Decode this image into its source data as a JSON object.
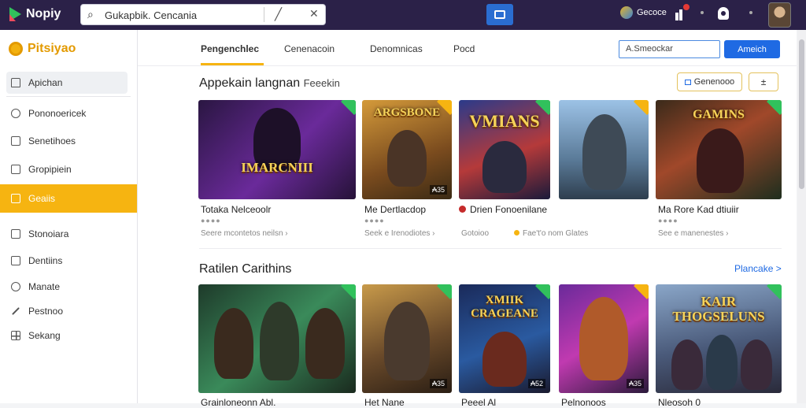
{
  "topbar": {
    "app_name": "Nopiy",
    "search_value": "Gukapbik. Cencania",
    "account_label": "Gecoce"
  },
  "sidebar": {
    "brand": "Pitsiyao",
    "items": [
      {
        "label": "Apichan",
        "icon": "home-icon"
      },
      {
        "label": "Pononoericek",
        "icon": "circle-icon"
      },
      {
        "label": "Senetihoes",
        "icon": "card-icon"
      },
      {
        "label": "Gropipiein",
        "icon": "window-icon"
      },
      {
        "label": "Geaiis",
        "icon": "square-icon"
      },
      {
        "label": "Stonoiara",
        "icon": "square-icon"
      },
      {
        "label": "Dentiins",
        "icon": "settings-icon"
      },
      {
        "label": "Manate",
        "icon": "location-icon"
      },
      {
        "label": "Pestnoo",
        "icon": "pen-icon"
      },
      {
        "label": "Sekang",
        "icon": "grid-icon"
      }
    ]
  },
  "tabs": [
    "Pengenchlec",
    "Cenenacoin",
    "Denomnicas",
    "Pocd"
  ],
  "right_search_value": "A.Smeockar",
  "right_button": "Ameich",
  "section1": {
    "title": "Appekain langnan",
    "subtitle": "Feeekin",
    "filter_button": "Genenooo",
    "cards": [
      {
        "title": "Totaka Nelceoolr",
        "sub": "Seere mcontetos neilsn",
        "art": "IMARCNIII",
        "badge": ""
      },
      {
        "title": "Me Dertlacdop",
        "sub": "Seek e Irenodiotes",
        "art": "ARGSBONE",
        "badge": "₳35"
      },
      {
        "title": "Drien Fonoenilane",
        "sub": "Gotoioo",
        "art": "VMIANS",
        "badge": ""
      },
      {
        "title": "",
        "sub": "Fae't'o nom Glates",
        "art": "",
        "badge": ""
      },
      {
        "title": "Ma Rore Kad dtiuiir",
        "sub": "See e manenestes",
        "art": "GAMINS",
        "badge": ""
      }
    ]
  },
  "section2": {
    "title": "Ratilen Carithins",
    "link": "Plancake >",
    "cards": [
      {
        "title": "Grainloneonn Abl.",
        "art": "",
        "badge": ""
      },
      {
        "title": "Het Nane",
        "art": "",
        "badge": "₳35"
      },
      {
        "title": "Peeel Al",
        "art": "XMIIK CRAGEANE",
        "badge": "₳52"
      },
      {
        "title": "Pelnonoos",
        "art": "",
        "badge": "₳35"
      },
      {
        "title": "Nleosoh 0",
        "art": "KAIR THOGSELUNS",
        "badge": ""
      }
    ]
  }
}
